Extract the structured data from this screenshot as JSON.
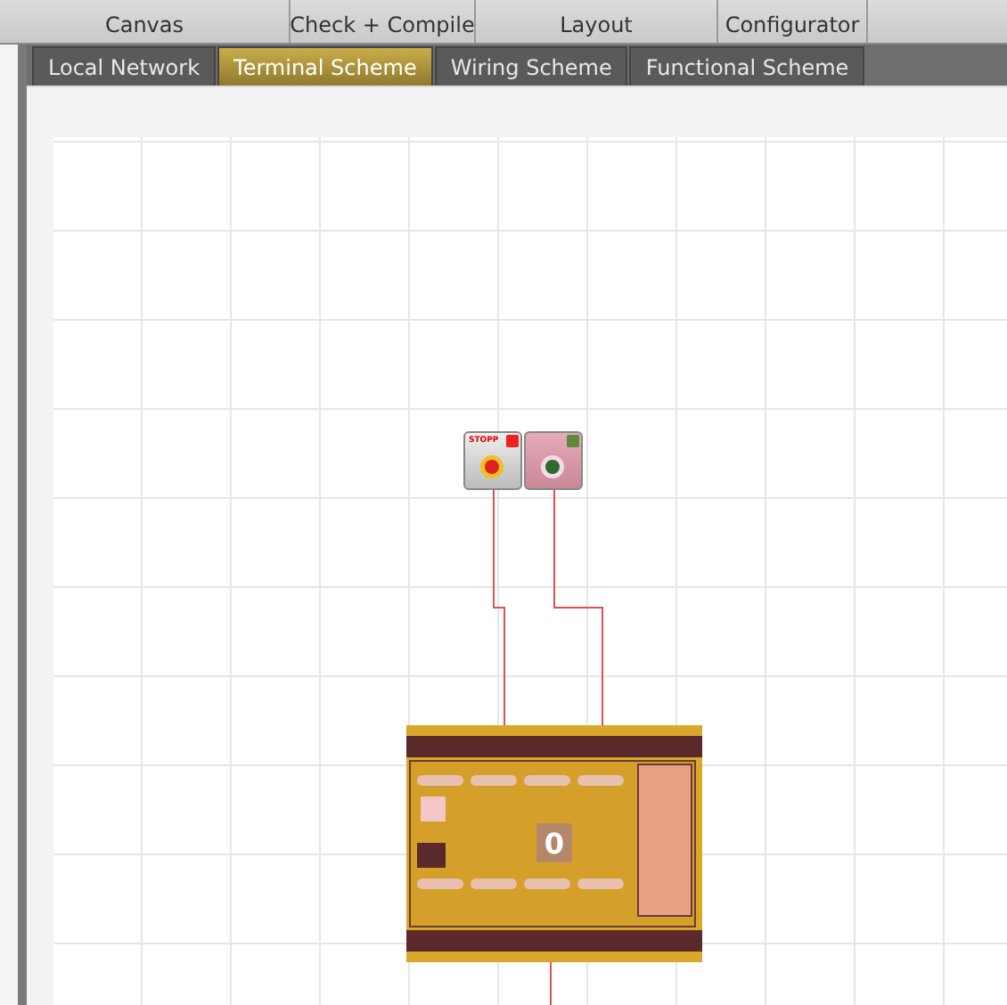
{
  "ribbon": {
    "groups": [
      {
        "label": "Canvas"
      },
      {
        "label": "Check + Compile"
      },
      {
        "label": "Layout"
      },
      {
        "label": "Configurator"
      }
    ]
  },
  "tabs": [
    {
      "label": "Local Network",
      "selected": false
    },
    {
      "label": "Terminal Scheme",
      "selected": true
    },
    {
      "label": "Wiring Scheme",
      "selected": false
    },
    {
      "label": "Functional Scheme",
      "selected": false
    }
  ],
  "canvas": {
    "buttons": [
      {
        "kind": "stop",
        "label": "STOPP"
      },
      {
        "kind": "push"
      }
    ],
    "controller": {
      "display": "0"
    }
  }
}
